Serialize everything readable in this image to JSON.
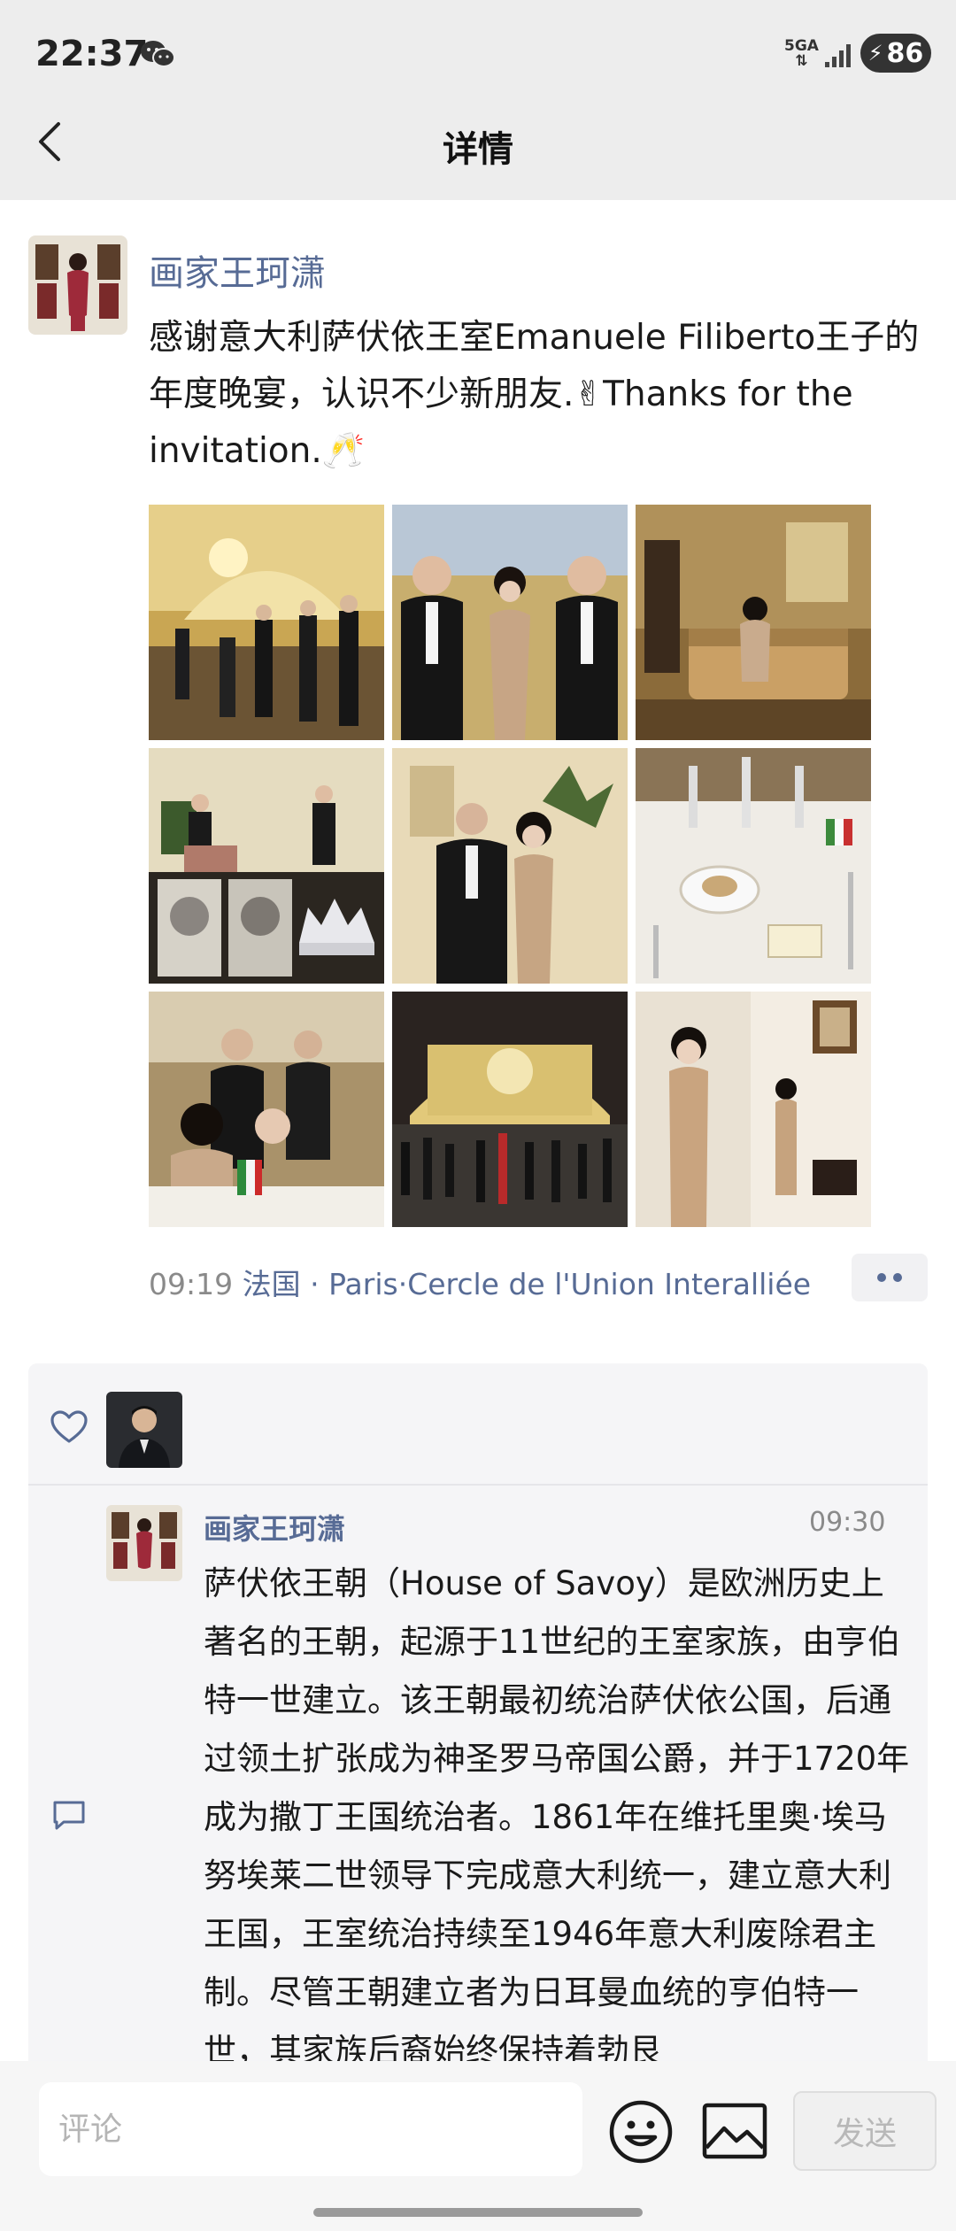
{
  "status_bar": {
    "time": "22:37",
    "network": "5GA",
    "battery": "86",
    "icons": [
      "wechat-icon",
      "signal-icon",
      "charging-icon"
    ]
  },
  "nav": {
    "title": "详情",
    "back_icon": "chevron-left-icon"
  },
  "post": {
    "author": "画家王珂潇",
    "text": "感谢意大利萨伏依王室Emanuele Filiberto王子的年度晚宴，认识不少新朋友.✌Thanks for the invitation.🥂",
    "photos_count_visible": 9,
    "time": "09:19",
    "location_country": "法国",
    "location_city": "Paris",
    "location_place": "Cercle de l'Union Interalliée",
    "sep": "·"
  },
  "interactions": {
    "like_icon": "heart-outline-icon",
    "comment_icon": "comment-bubble-icon",
    "comment": {
      "author": "画家王珂潇",
      "time": "09:30",
      "text": "萨伏依王朝（House of Savoy）是欧洲历史上著名的王朝，起源于11世纪的王室家族，由亨伯特一世建立。该王朝最初统治萨伏依公国，后通过领土扩张成为神圣罗马帝国公爵，并于1720年成为撒丁王国统治者。1861年在维托里奥·埃马努埃莱二世领导下完成意大利统一，建立意大利王国，王室统治持续至1946年意大利废除君主制。尽管王朝建立者为日耳曼血统的亨伯特一世，其家族后裔始终保持着勃艮"
    }
  },
  "input_bar": {
    "placeholder": "评论",
    "send_label": "发送",
    "emoji_icon": "emoji-icon",
    "image_icon": "image-icon"
  },
  "colors": {
    "link": "#576b95",
    "header_bg": "#ededed",
    "panel_bg": "#f5f5f7"
  }
}
